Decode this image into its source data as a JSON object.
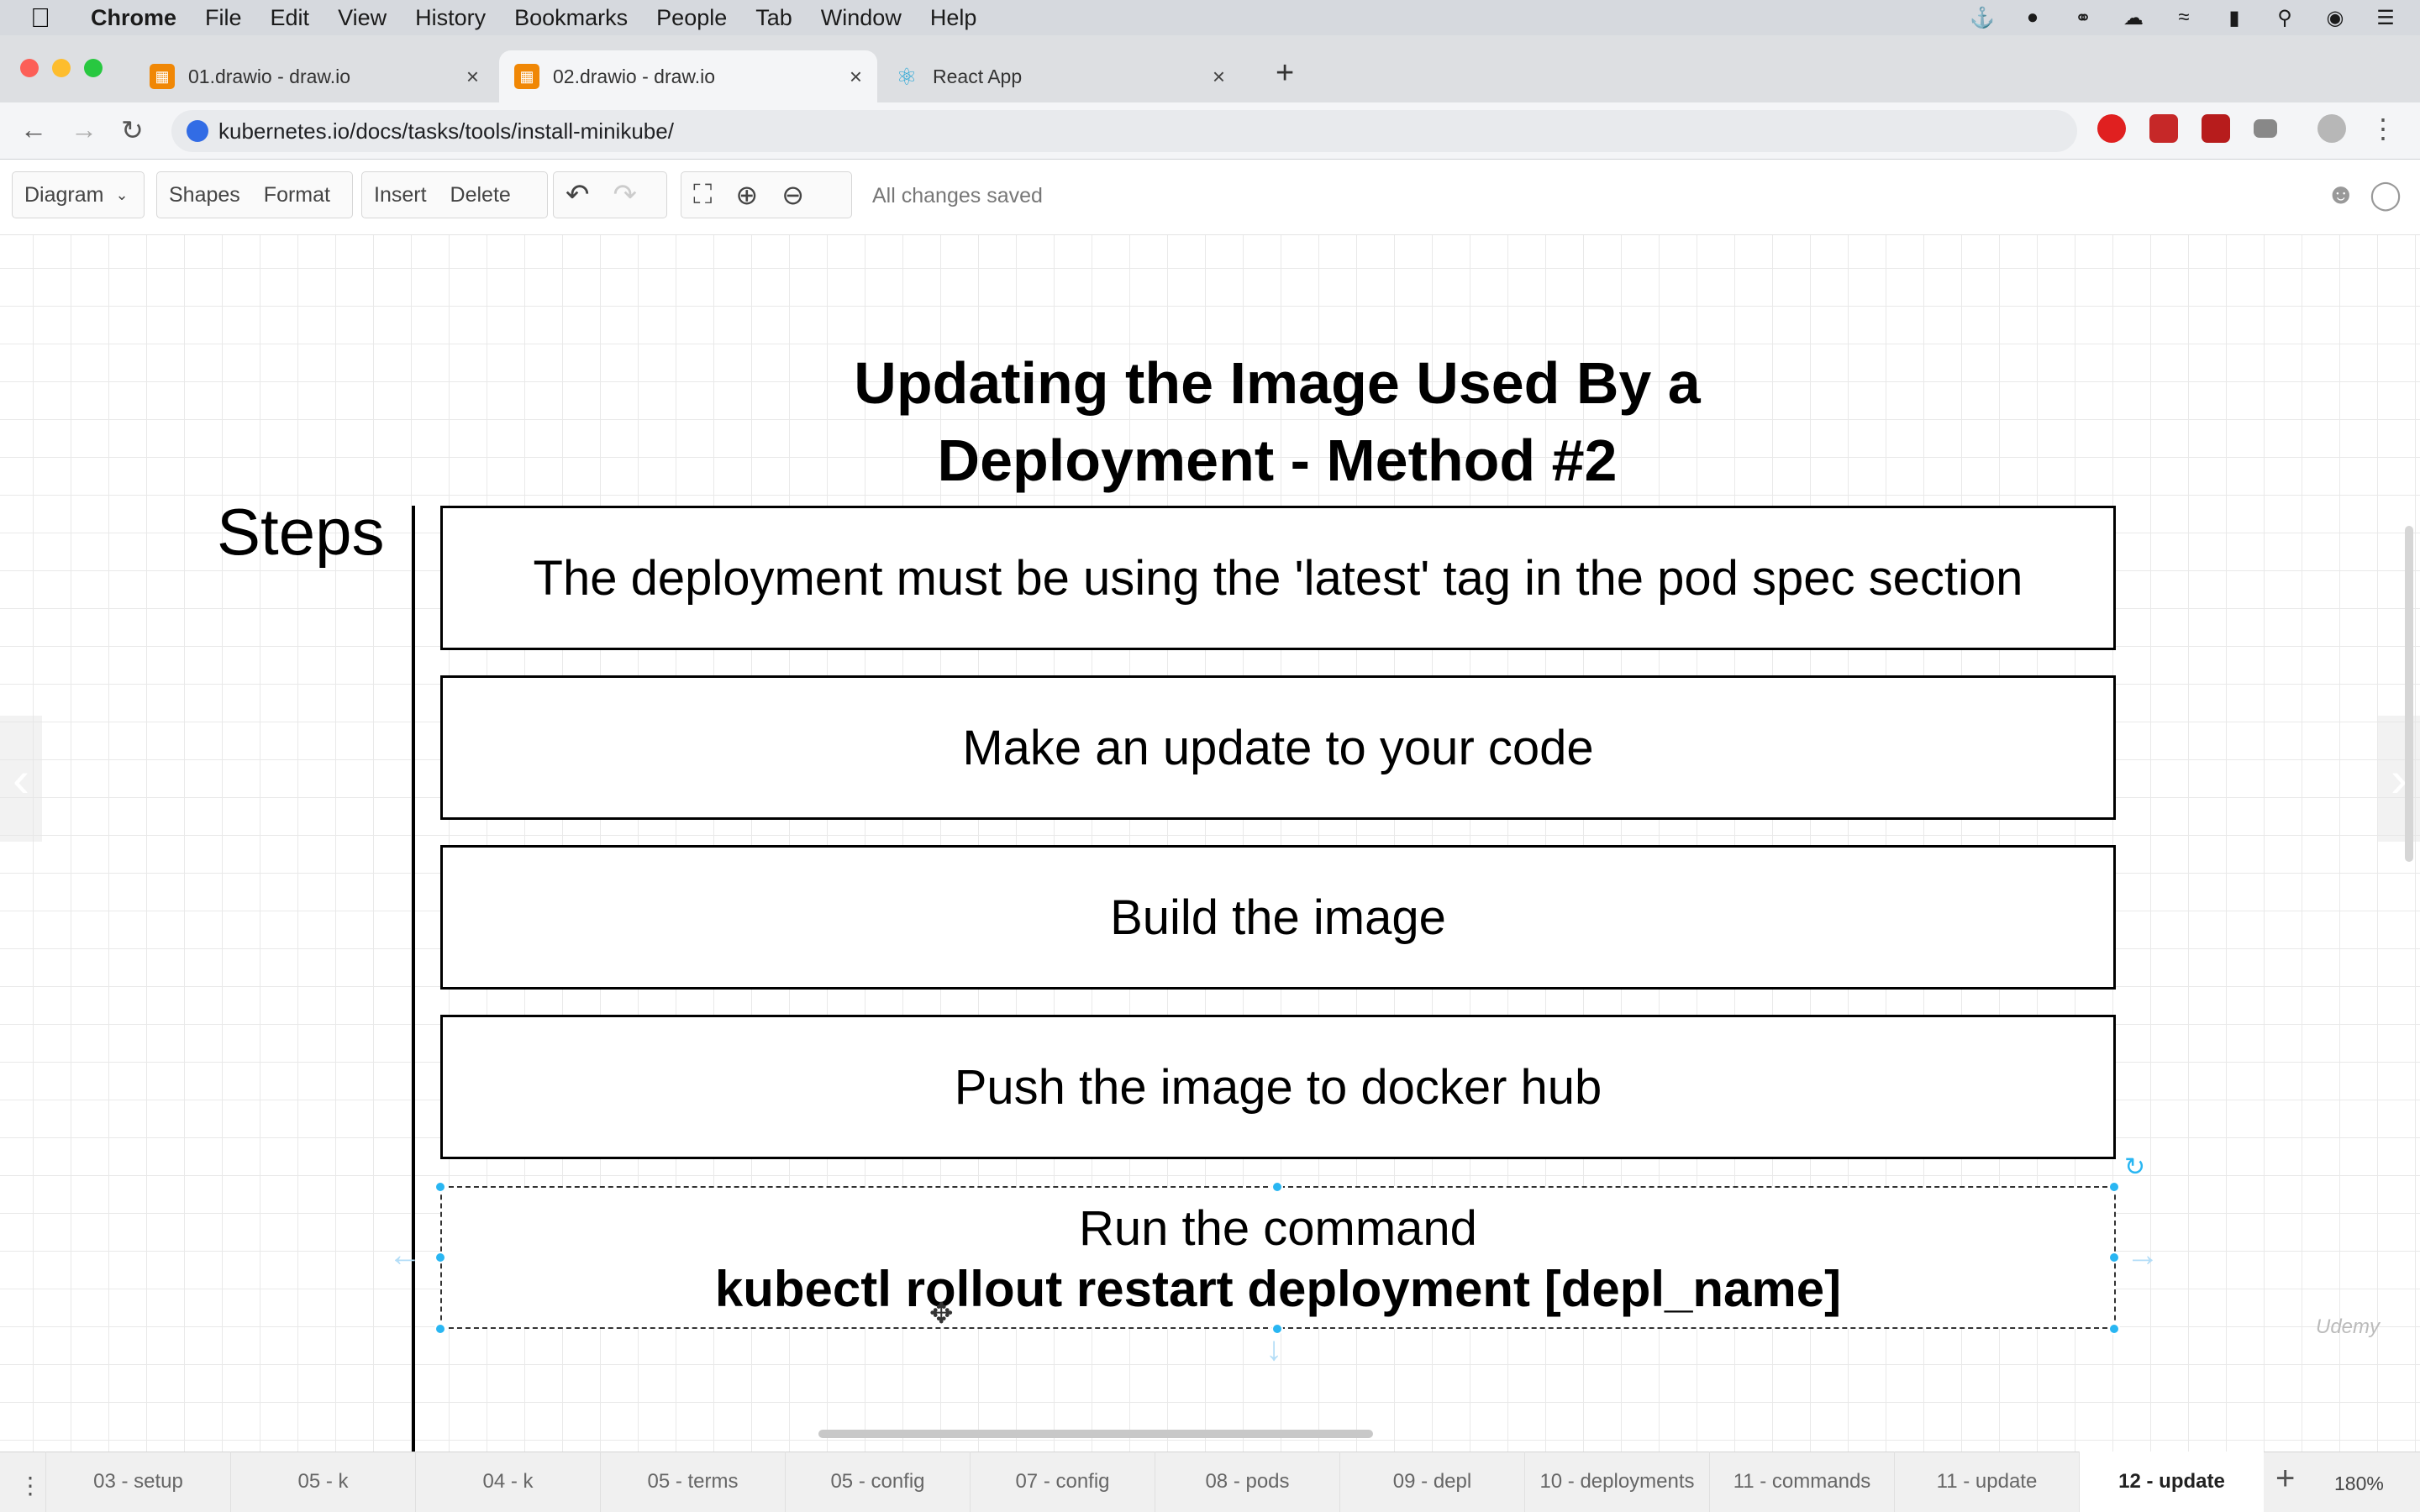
{
  "menubar": {
    "app_name": "Chrome",
    "items": [
      "File",
      "Edit",
      "View",
      "History",
      "Bookmarks",
      "People",
      "Tab",
      "Window",
      "Help"
    ]
  },
  "tabs": [
    {
      "title": "01.drawio - draw.io",
      "icon": "drawio-icon",
      "active": false
    },
    {
      "title": "02.drawio - draw.io",
      "icon": "drawio-icon",
      "active": true
    },
    {
      "title": "React App",
      "icon": "react-icon",
      "active": false
    }
  ],
  "address": {
    "url": "kubernetes.io/docs/tasks/tools/install-minikube/"
  },
  "toolbar": {
    "diagram_label": "Diagram",
    "shapes_label": "Shapes",
    "format_label": "Format",
    "insert_label": "Insert",
    "delete_label": "Delete",
    "status": "All changes saved"
  },
  "diagram": {
    "title_line1": "Updating the Image Used By a",
    "title_line2": "Deployment - Method #2",
    "steps_label": "Steps",
    "boxes": [
      "The deployment must be using the 'latest' tag in the pod spec section",
      "Make an update to your code",
      "Build the image",
      "Push the image to docker hub"
    ],
    "last_box": {
      "line1": "Run the command",
      "line2": "kubectl rollout restart deployment [depl_name]"
    }
  },
  "page_tabs": [
    "03 - setup",
    "05 - k",
    "04 - k",
    "05 - terms",
    "05 - config",
    "07 - config",
    "08 - pods",
    "09 - depl",
    "10 - deployments",
    "11 - commands",
    "11 - update",
    "12 - update"
  ],
  "active_page": "12 - update",
  "zoom": "180%",
  "colors": {
    "selection": "#29b6f2",
    "menubar": "#d6d9de",
    "tabstrip": "#dddfe2"
  }
}
